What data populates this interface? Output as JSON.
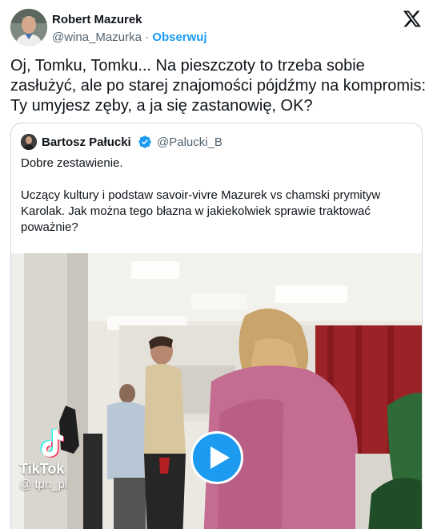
{
  "colors": {
    "accent": "#1d9bf0",
    "text": "#0f1419",
    "secondary": "#536471",
    "border": "#cfd9de"
  },
  "tweet": {
    "author_name": "Robert Mazurek",
    "author_handle": "@wina_Mazurka",
    "separator": "·",
    "follow_label": "Obserwuj",
    "text": "Oj, Tomku, Tomku... Na pieszczoty to trzeba sobie zasłużyć, ale po starej znajomości pójdźmy na kompromis: Ty umyjesz zęby, a ja się zastanowię, OK?",
    "logo_icon": "x-logo-icon"
  },
  "quoted": {
    "author_name": "Bartosz Pałucki",
    "verified_icon": "verified-badge-icon",
    "author_handle": "@Palucki_B",
    "text": "Dobre zestawienie.\n\nUczący kultury i podstaw savoir-vivre Mazurek vs chamski prymityw Karolak. Jak można tego błazna w jakiekolwiek sprawie traktować poważnie?",
    "media": {
      "watermark_brand": "TikTok",
      "watermark_user": "@ tpn_pl",
      "play_icon": "play-icon"
    }
  }
}
